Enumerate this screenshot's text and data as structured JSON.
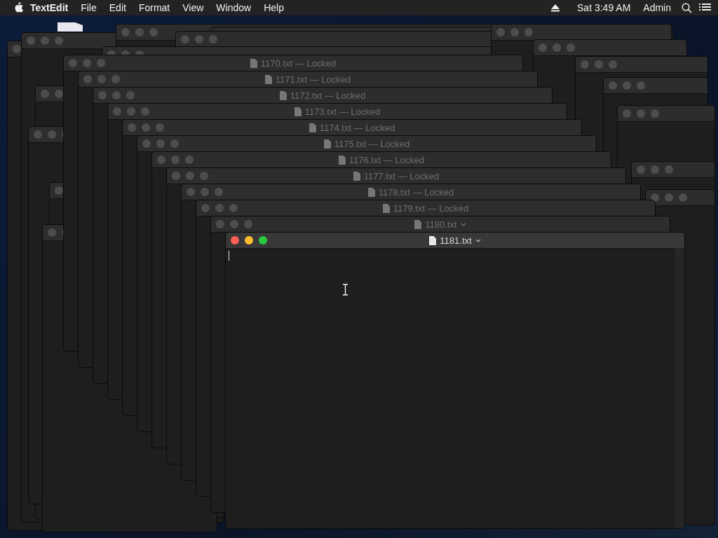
{
  "menu_bar": {
    "app_name": "TextEdit",
    "menus": [
      "File",
      "Edit",
      "Format",
      "View",
      "Window",
      "Help"
    ],
    "clock": "Sat 3:49 AM",
    "user": "Admin"
  },
  "windows": [
    {
      "title": "1170.txt — Locked",
      "chevron": false,
      "active": false
    },
    {
      "title": "1171.txt — Locked",
      "chevron": false,
      "active": false
    },
    {
      "title": "1172.txt — Locked",
      "chevron": false,
      "active": false
    },
    {
      "title": "1173.txt — Locked",
      "chevron": false,
      "active": false
    },
    {
      "title": "1174.txt — Locked",
      "chevron": false,
      "active": false
    },
    {
      "title": "1175.txt — Locked",
      "chevron": false,
      "active": false
    },
    {
      "title": "1176.txt — Locked",
      "chevron": false,
      "active": false
    },
    {
      "title": "1177.txt — Locked",
      "chevron": false,
      "active": false
    },
    {
      "title": "1178.txt — Locked",
      "chevron": false,
      "active": false
    },
    {
      "title": "1179.txt — Locked",
      "chevron": false,
      "active": false
    },
    {
      "title": "1180.txt",
      "chevron": true,
      "active": false
    },
    {
      "title": "1181.txt",
      "chevron": true,
      "active": true
    }
  ]
}
